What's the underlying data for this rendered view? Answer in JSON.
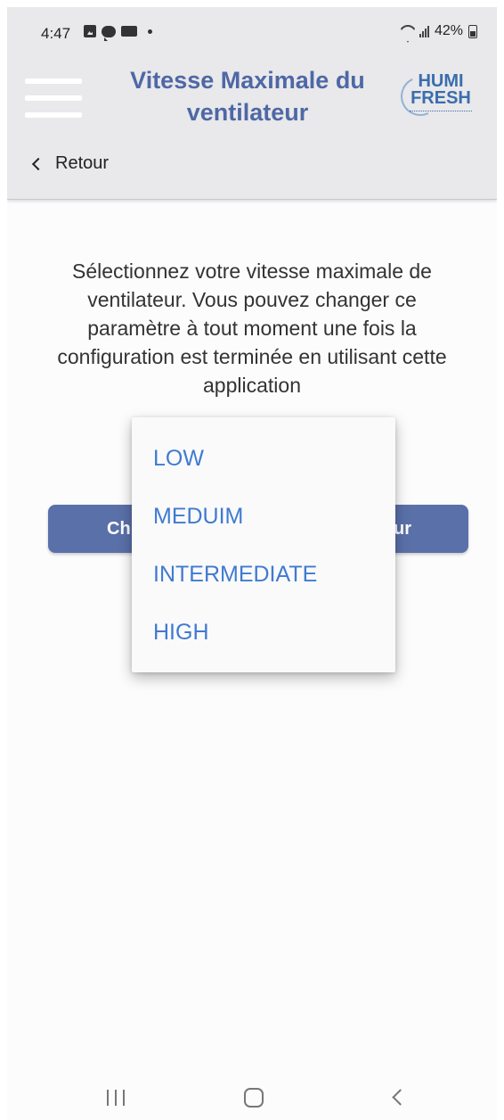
{
  "status_bar": {
    "time": "4:47",
    "battery": "42%",
    "icons": [
      "photo-icon",
      "chat-icon",
      "mail-icon",
      "dot-icon",
      "wifi-icon",
      "signal-icon",
      "battery-icon"
    ]
  },
  "header": {
    "title": "Vitesse Maximale du ventilateur",
    "logo_text": "HUMI FRESH",
    "back_label": "Retour",
    "menu_icon": "hamburger-menu-icon"
  },
  "main": {
    "description": "Sélectionnez votre vitesse maximale de ventilateur. Vous pouvez changer ce paramètre à tout moment une fois la configuration est terminée en utilisant cette application",
    "button_left": "Ch",
    "button_right": "ur"
  },
  "dropdown": {
    "options": [
      "LOW",
      "MEDUIM",
      "INTERMEDIATE",
      "HIGH"
    ]
  },
  "nav_bar": {
    "icons": [
      "recent-apps-icon",
      "home-icon",
      "back-icon"
    ]
  },
  "colors": {
    "title": "#4e68a6",
    "button": "#5a70a9",
    "option_text": "#3f7bd0",
    "header_bg": "#e9e8ea"
  }
}
